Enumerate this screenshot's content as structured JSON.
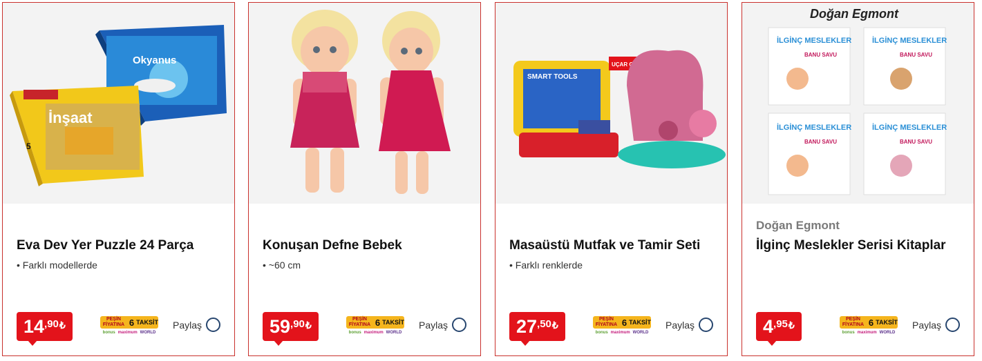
{
  "cards": [
    {
      "brand": "",
      "title": "Eva Dev Yer Puzzle 24 Parça",
      "feature": "• Farklı modellerde",
      "price_int": "14",
      "price_dec": ",90",
      "currency": "₺",
      "taksit_pesin": "PEŞİN FİYATINA",
      "taksit_count": "6",
      "taksit_word": "TAKSİT",
      "card_bonus": "bonus",
      "card_maximum": "maximum",
      "card_world": "WORLD",
      "share": "Paylaş",
      "image_texts": [
        "Okyanus",
        "İnşaat",
        "5"
      ]
    },
    {
      "brand": "",
      "title": "Konuşan Defne Bebek",
      "feature": "• ~60 cm",
      "price_int": "59",
      "price_dec": ",90",
      "currency": "₺",
      "taksit_pesin": "PEŞİN FİYATINA",
      "taksit_count": "6",
      "taksit_word": "TAKSİT",
      "card_bonus": "bonus",
      "card_maximum": "maximum",
      "card_world": "WORLD",
      "share": "Paylaş",
      "image_texts": []
    },
    {
      "brand": "",
      "title": "Masaüstü Mutfak ve Tamir Seti",
      "feature": "• Farklı renklerde",
      "price_int": "27",
      "price_dec": ",50",
      "currency": "₺",
      "taksit_pesin": "PEŞİN FİYATINA",
      "taksit_count": "6",
      "taksit_word": "TAKSİT",
      "card_bonus": "bonus",
      "card_maximum": "maximum",
      "card_world": "WORLD",
      "share": "Paylaş",
      "image_texts": [
        "SMART TOOLS",
        "UÇAR OYUNCAK"
      ]
    },
    {
      "brand": "Doğan Egmont",
      "title": "İlginç Meslekler Serisi Kitaplar",
      "feature": "",
      "price_int": "4",
      "price_dec": ",95",
      "currency": "₺",
      "taksit_pesin": "PEŞİN FİYATINA",
      "taksit_count": "6",
      "taksit_word": "TAKSİT",
      "card_bonus": "bonus",
      "card_maximum": "maximum",
      "card_world": "WORLD",
      "share": "Paylaş",
      "image_texts": [
        "Doğan Egmont",
        "İLGİNÇ MESLEKLER",
        "BANU SAVU"
      ]
    }
  ],
  "colors": {
    "border": "#c9302c",
    "price_bg": "#e3131b",
    "taksit_bg": "#f5b51d",
    "share_circle": "#27466f"
  }
}
